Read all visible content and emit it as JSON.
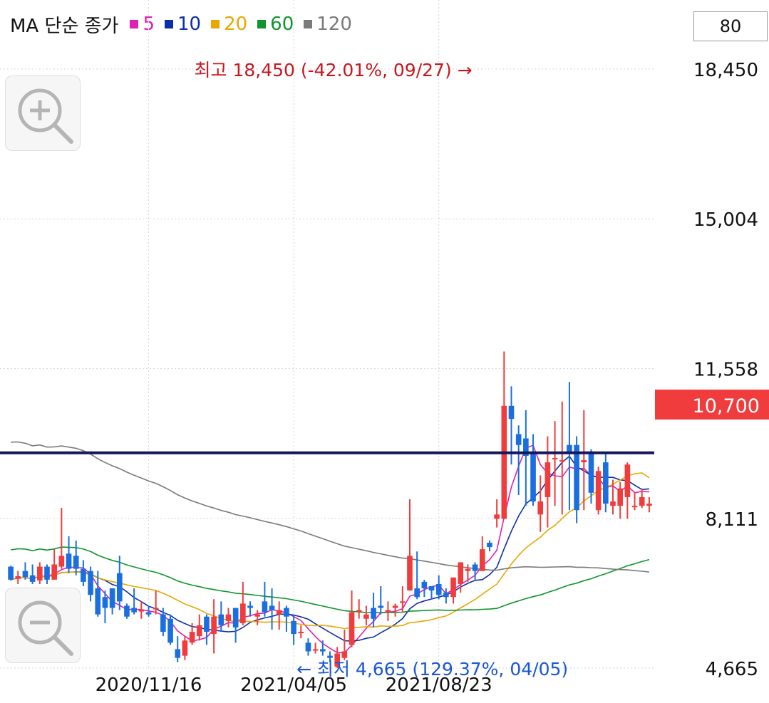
{
  "legend": {
    "title": "MA 단순 종가",
    "items": [
      {
        "label": "5",
        "color": "#e020b0"
      },
      {
        "label": "10",
        "color": "#0c2fa8"
      },
      {
        "label": "20",
        "color": "#e8a800"
      },
      {
        "label": "60",
        "color": "#10952c"
      },
      {
        "label": "120",
        "color": "#7a7a7a"
      }
    ]
  },
  "period_box": "80",
  "high_label": "최고 18,450 (-42.01%, 09/27) →",
  "low_label": "← 최저 4,665 (129.37%, 04/05)",
  "current_price_label": "10,700",
  "zoom_in_icon": "zoom-in-icon",
  "zoom_out_icon": "zoom-out-icon",
  "colors": {
    "up": "#f03c3c",
    "down": "#1a6fe0",
    "high_text": "#c8161e",
    "low_text": "#1a56d6",
    "price_box": "#f03c3c",
    "hline": "#16165e"
  },
  "chart_data": {
    "type": "candlestick",
    "y_ticks": [
      {
        "label": "18,450",
        "value": 18450
      },
      {
        "label": "15,004",
        "value": 15004
      },
      {
        "label": "11,558",
        "value": 11558
      },
      {
        "label": "8,111",
        "value": 8111
      },
      {
        "label": "4,665",
        "value": 4665
      }
    ],
    "ylim": [
      4665,
      18450
    ],
    "x_ticks": [
      {
        "label": "2020/11/16",
        "index": 19
      },
      {
        "label": "2021/04/05",
        "index": 39
      },
      {
        "label": "2021/08/23",
        "index": 59
      }
    ],
    "horizontal_line": 9620,
    "current_price": 10700,
    "high": {
      "value": 18450,
      "index": 64
    },
    "low": {
      "value": 4665,
      "index": 39
    },
    "candles": [
      [
        7000,
        6700,
        7020,
        6680
      ],
      [
        6720,
        6780,
        6900,
        6600
      ],
      [
        6900,
        6760,
        7100,
        6700
      ],
      [
        6800,
        6650,
        7050,
        6600
      ],
      [
        6680,
        7000,
        7100,
        6600
      ],
      [
        7000,
        6700,
        7050,
        6600
      ],
      [
        6700,
        7050,
        7400,
        6700
      ],
      [
        7000,
        7250,
        8350,
        6950
      ],
      [
        7300,
        6950,
        7700,
        6850
      ],
      [
        7250,
        6950,
        7600,
        6800
      ],
      [
        6950,
        6650,
        7150,
        6550
      ],
      [
        6900,
        6350,
        7000,
        6200
      ],
      [
        6500,
        5900,
        6900,
        5850
      ],
      [
        6300,
        6050,
        6450,
        5700
      ],
      [
        6500,
        6050,
        6500,
        5900
      ],
      [
        6850,
        6200,
        7250,
        6000
      ],
      [
        6100,
        5850,
        6150,
        5800
      ],
      [
        6050,
        5950,
        6500,
        5900
      ],
      [
        6000,
        6000,
        6200,
        5800
      ],
      [
        5950,
        5900,
        6100,
        5850
      ],
      [
        6050,
        6050,
        6450,
        5900
      ],
      [
        5900,
        5500,
        6050,
        5400
      ],
      [
        5800,
        5250,
        5900,
        5200
      ],
      [
        5100,
        4900,
        5400,
        4800
      ],
      [
        4950,
        5300,
        5400,
        4850
      ],
      [
        5250,
        5500,
        5700,
        5200
      ],
      [
        5400,
        5650,
        5900,
        5300
      ],
      [
        5850,
        5500,
        5900,
        5200
      ],
      [
        5450,
        5850,
        6250,
        5000
      ],
      [
        5900,
        5650,
        6200,
        5500
      ],
      [
        5750,
        5900,
        6050,
        5600
      ],
      [
        6050,
        5600,
        6050,
        5250
      ],
      [
        5700,
        6150,
        6650,
        5650
      ],
      [
        6100,
        6050,
        6200,
        5850
      ],
      [
        5850,
        5900,
        6000,
        5650
      ],
      [
        6200,
        5950,
        6650,
        5850
      ],
      [
        6100,
        6000,
        6500,
        5550
      ],
      [
        5900,
        6000,
        6200,
        5550
      ],
      [
        6050,
        5850,
        6100,
        5500
      ],
      [
        5750,
        5450,
        5900,
        5200
      ],
      [
        5500,
        5500,
        5650,
        5350
      ],
      [
        5250,
        5050,
        5350,
        4950
      ],
      [
        5100,
        5100,
        5250,
        5000
      ],
      [
        5100,
        5050,
        5300,
        4950
      ],
      [
        4950,
        4900,
        5050,
        4800
      ],
      [
        4700,
        5000,
        5150,
        4665
      ],
      [
        4900,
        5050,
        5550,
        4850
      ],
      [
        5200,
        5950,
        6450,
        5150
      ],
      [
        6000,
        6000,
        6250,
        5800
      ],
      [
        5800,
        5900,
        6100,
        5650
      ],
      [
        6050,
        5800,
        6400,
        5600
      ],
      [
        6100,
        6050,
        6550,
        5900
      ],
      [
        5950,
        6000,
        6200,
        5750
      ],
      [
        6050,
        6100,
        6150,
        5850
      ],
      [
        6200,
        6200,
        6550,
        5950
      ],
      [
        6450,
        7250,
        8550,
        6500
      ],
      [
        6500,
        6300,
        7350,
        6250
      ],
      [
        6650,
        6500,
        6700,
        6300
      ],
      [
        6550,
        6450,
        6550,
        6250
      ],
      [
        6600,
        6350,
        6800,
        6250
      ],
      [
        6400,
        6300,
        6500,
        6150
      ],
      [
        6300,
        6750,
        6600,
        6150
      ],
      [
        6600,
        7100,
        6900,
        6400
      ],
      [
        6900,
        6950,
        7050,
        6650
      ],
      [
        7050,
        6900,
        7100,
        6700
      ],
      [
        6900,
        7400,
        7700,
        6900
      ],
      [
        7550,
        7450,
        7600,
        7350
      ],
      [
        8100,
        8200,
        8550,
        7900
      ],
      [
        8100,
        10700,
        11950,
        8100
      ],
      [
        10700,
        10400,
        11150,
        9350
      ],
      [
        10050,
        9800,
        10250,
        8650
      ],
      [
        9950,
        9550,
        10600,
        8400
      ],
      [
        9650,
        8500,
        10050,
        8400
      ],
      [
        8200,
        8500,
        9100,
        7800
      ],
      [
        8600,
        9400,
        10000,
        7900
      ],
      [
        9500,
        9500,
        10350,
        8400
      ],
      [
        9450,
        9450,
        10800,
        8200
      ],
      [
        9800,
        9600,
        11250,
        8300
      ],
      [
        9800,
        8300,
        10000,
        8000
      ],
      [
        9400,
        9450,
        10600,
        8300
      ],
      [
        9650,
        8700,
        9700,
        8450
      ],
      [
        8300,
        9200,
        9300,
        8200
      ],
      [
        9400,
        8450,
        9650,
        8250
      ],
      [
        8400,
        8500,
        9000,
        8200
      ],
      [
        8400,
        8800,
        8950,
        8100
      ],
      [
        8600,
        9350,
        9400,
        8100
      ],
      [
        8400,
        8400,
        8700,
        8300
      ],
      [
        8400,
        8600,
        8800,
        8350
      ],
      [
        8400,
        8450,
        8600,
        8250
      ]
    ]
  }
}
